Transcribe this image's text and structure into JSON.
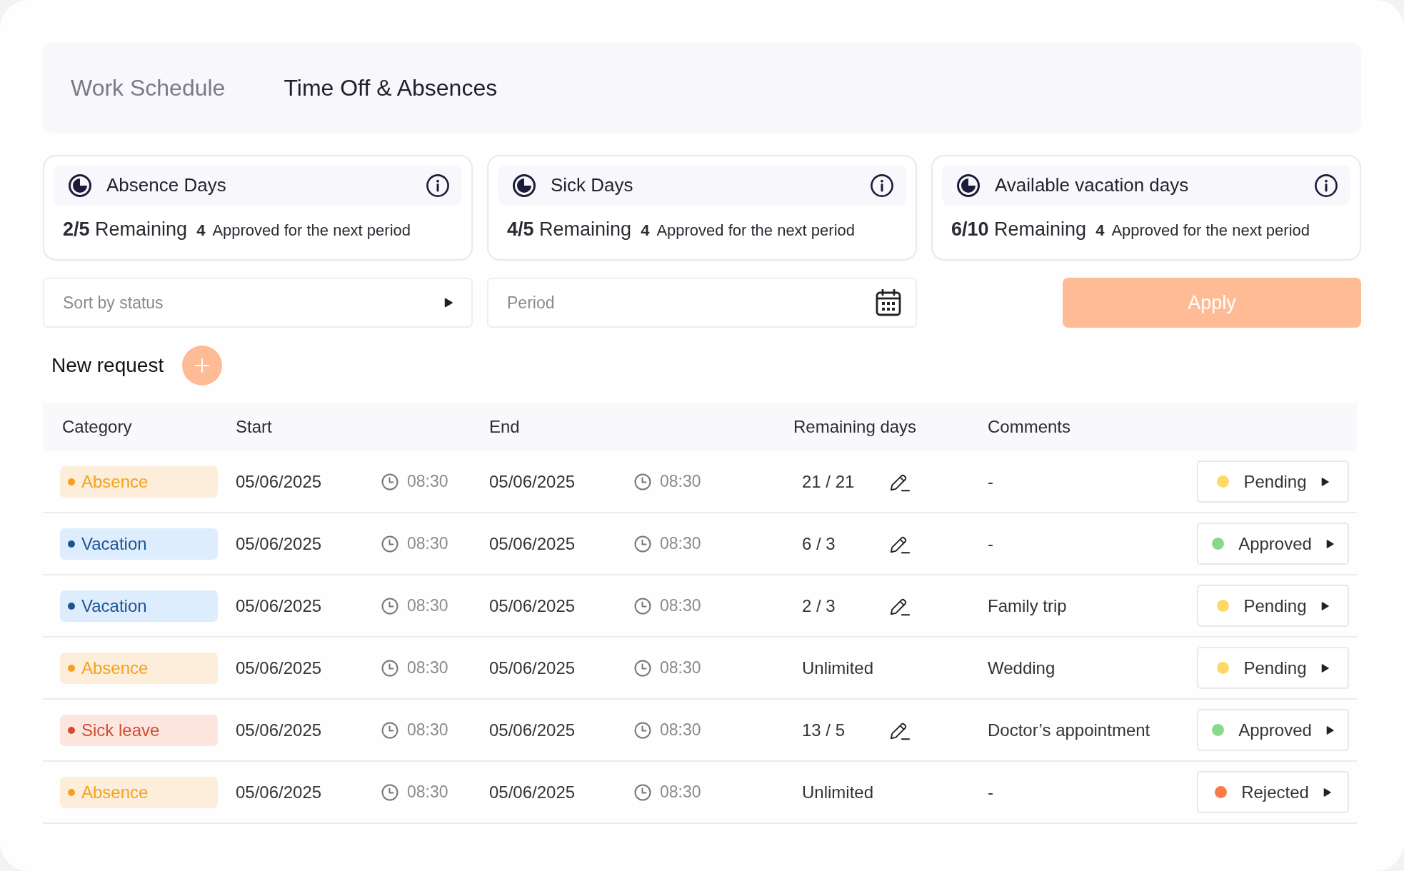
{
  "tabs": [
    {
      "label": "Work Schedule",
      "selected": false
    },
    {
      "label": "Time Off & Absences",
      "selected": true
    }
  ],
  "summary_cards": [
    {
      "title": "Absence Days",
      "remaining": "**2/5** Remaining",
      "approved_count": "4",
      "approved_label": "Approved for the next period"
    },
    {
      "title": "Sick Days",
      "remaining": "**4/5** Remaining",
      "approved_count": "4",
      "approved_label": "Approved for the next period"
    },
    {
      "title": "Available vacation days",
      "remaining": "**6/10** Remaining",
      "approved_count": "4",
      "approved_label": "Approved for the next period"
    }
  ],
  "filters": {
    "status_select": {
      "placeholder": "Sort by status"
    },
    "period_field": {
      "placeholder": "Period"
    },
    "apply_button": {
      "label": "Apply"
    }
  },
  "new_request": {
    "label": "New request"
  },
  "table": {
    "columns": [
      "Category",
      "Start",
      "End",
      "Remaining days",
      "Comments"
    ],
    "rows": [
      {
        "category": {
          "label": "Absence",
          "kind": "absence",
          "color": "#f7a01b"
        },
        "start_date": "05/06/2025",
        "start_time": "08:30",
        "end_date": "05/06/2025",
        "end_time": "08:30",
        "remaining_days": "21 / 21",
        "editable": true,
        "comment": "-",
        "status": {
          "label": "Pending",
          "color": "#ffd966"
        }
      },
      {
        "category": {
          "label": "Vacation",
          "kind": "vacation",
          "color": "#1e5591"
        },
        "start_date": "05/06/2025",
        "start_time": "08:30",
        "end_date": "05/06/2025",
        "end_time": "08:30",
        "remaining_days": "6 / 3",
        "editable": true,
        "comment": "-",
        "status": {
          "label": "Approved",
          "color": "#88d98b"
        }
      },
      {
        "category": {
          "label": "Vacation",
          "kind": "vacation",
          "color": "#1e5591"
        },
        "start_date": "05/06/2025",
        "start_time": "08:30",
        "end_date": "05/06/2025",
        "end_time": "08:30",
        "remaining_days": "2 / 3",
        "editable": true,
        "comment": "Family trip",
        "status": {
          "label": "Pending",
          "color": "#ffd966"
        }
      },
      {
        "category": {
          "label": "Absence",
          "kind": "absence",
          "color": "#f7a01b"
        },
        "start_date": "05/06/2025",
        "start_time": "08:30",
        "end_date": "05/06/2025",
        "end_time": "08:30",
        "remaining_days": "Unlimited",
        "editable": false,
        "comment": "Wedding",
        "status": {
          "label": "Pending",
          "color": "#ffd966"
        }
      },
      {
        "category": {
          "label": "Sick leave",
          "kind": "sick_leave",
          "color": "#d24e2c"
        },
        "start_date": "05/06/2025",
        "start_time": "08:30",
        "end_date": "05/06/2025",
        "end_time": "08:30",
        "remaining_days": "13 / 5",
        "editable": true,
        "comment": "Doctor’s appointment",
        "status": {
          "label": "Approved",
          "color": "#88d98b"
        }
      },
      {
        "category": {
          "label": "Absence",
          "kind": "absence",
          "color": "#f7a01b"
        },
        "start_date": "05/06/2025",
        "start_time": "08:30",
        "end_date": "05/06/2025",
        "end_time": "08:30",
        "remaining_days": "Unlimited",
        "editable": false,
        "comment": "-",
        "status": {
          "label": "Rejected",
          "color": "#fa7b4a"
        }
      }
    ]
  }
}
